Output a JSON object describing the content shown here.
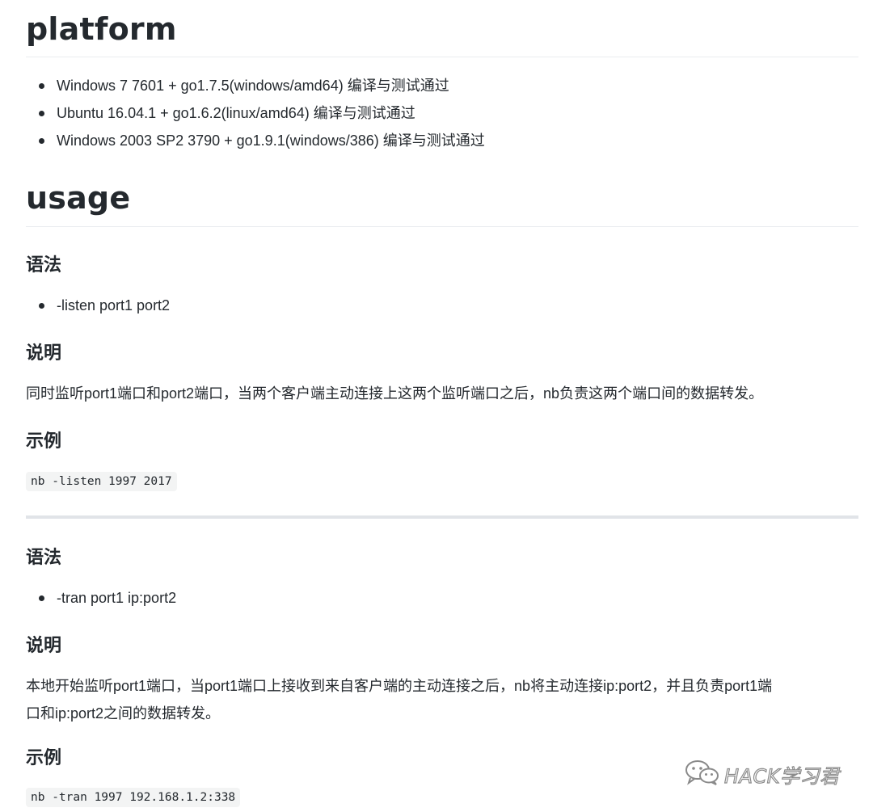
{
  "platform": {
    "heading": "platform",
    "items": [
      "Windows 7 7601 + go1.7.5(windows/amd64) 编译与测试通过",
      "Ubuntu 16.04.1 + go1.6.2(linux/amd64) 编译与测试通过",
      "Windows 2003 SP2 3790 + go1.9.1(windows/386) 编译与测试通过"
    ]
  },
  "usage": {
    "heading": "usage",
    "listen": {
      "syntax_heading": "语法",
      "syntax_item": "-listen port1 port2",
      "desc_heading": "说明",
      "desc_text": "同时监听port1端口和port2端口，当两个客户端主动连接上这两个监听端口之后，nb负责这两个端口间的数据转发。",
      "example_heading": "示例",
      "example_code": "nb -listen 1997 2017"
    },
    "tran": {
      "syntax_heading": "语法",
      "syntax_item": "-tran port1 ip:port2",
      "desc_heading": "说明",
      "desc_line1": "本地开始监听port1端口，当port1端口上接收到来自客户端的主动连接之后，nb将主动连接ip:port2，并且负责port1端",
      "desc_line2": "口和ip:port2之间的数据转发。",
      "example_heading": "示例",
      "example_code": "nb -tran 1997 192.168.1.2:338"
    }
  },
  "watermark": {
    "text": "HACK学习君",
    "icon": "wechat-icon"
  }
}
